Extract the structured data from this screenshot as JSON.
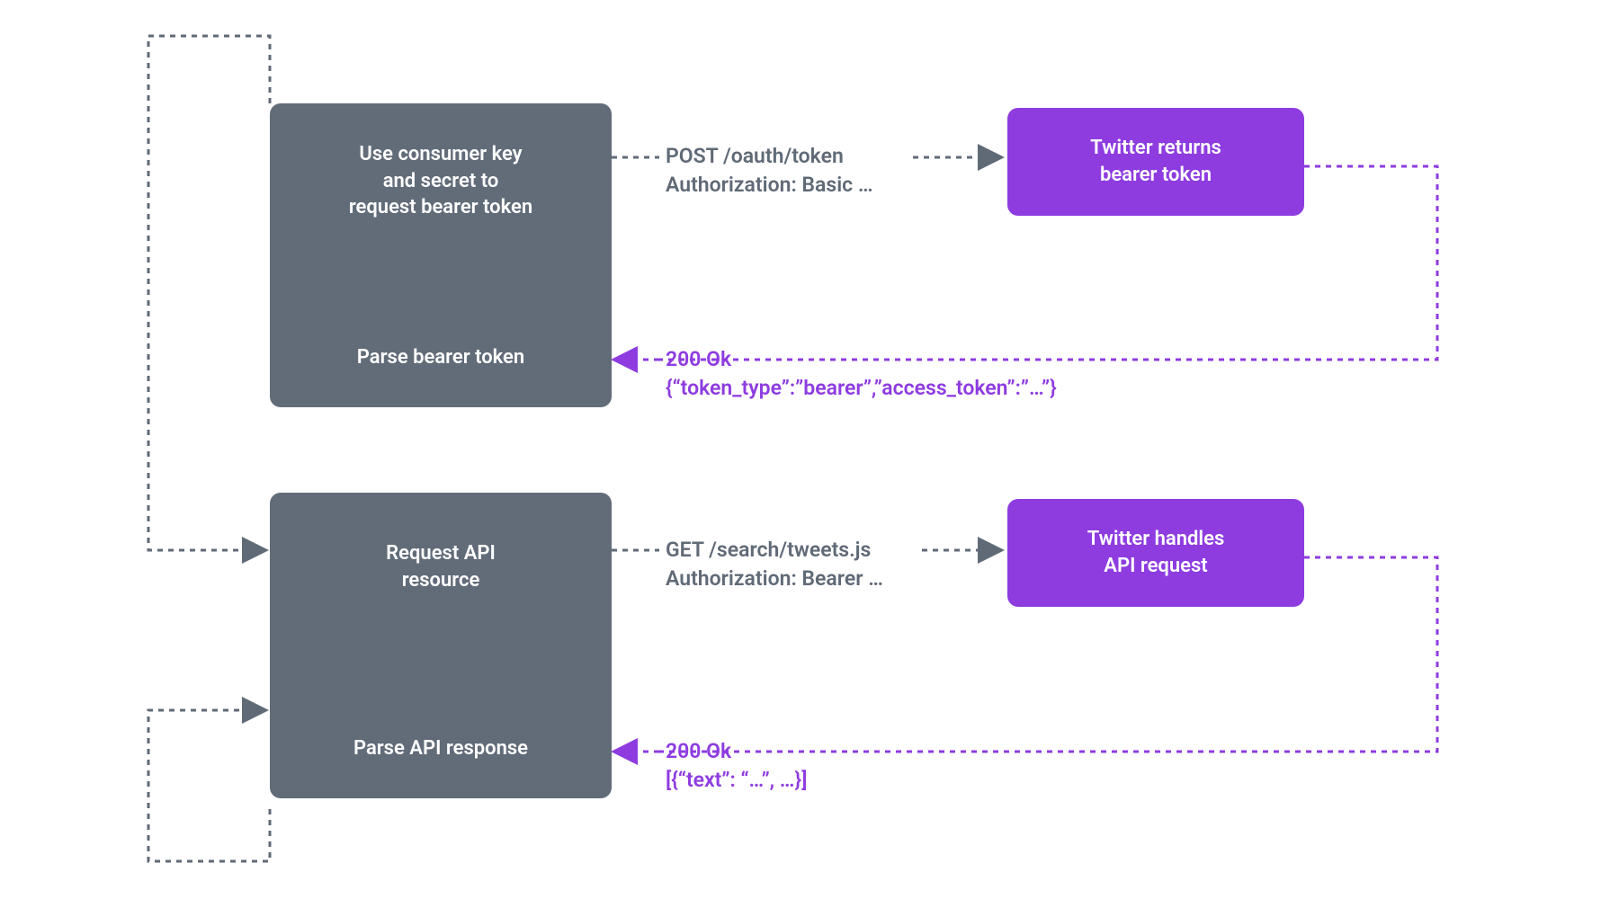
{
  "boxes": {
    "client1": {
      "top": "Use consumer key\nand secret to\nrequest bearer token",
      "bottom": "Parse bearer token"
    },
    "server1": "Twitter returns\nbearer token",
    "client2": {
      "top": "Request API\nresource",
      "bottom": "Parse API response"
    },
    "server2": "Twitter handles\nAPI request"
  },
  "labels": {
    "req1_l1": "POST /oauth/token",
    "req1_l2": "Authorization: Basic …",
    "resp1_l1": "200 Ok",
    "resp1_l2": "{“token_type”:”bearer”,”access_token”:”…”}",
    "req2_l1": "GET /search/tweets.js",
    "req2_l2": "Authorization: Bearer …",
    "resp2_l1": "200 Ok",
    "resp2_l2": "[{“text”: “…”, …}]"
  },
  "colors": {
    "gray": "#606A77",
    "purple": "#8E3CE0"
  }
}
